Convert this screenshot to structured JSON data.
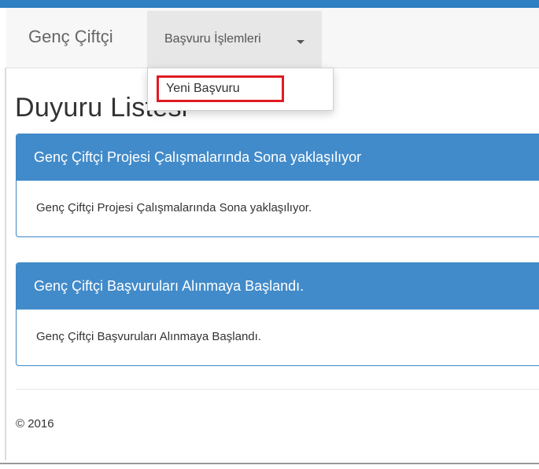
{
  "navbar": {
    "brand": "Genç Çiftçi",
    "menu_label": "Başvuru İşlemleri",
    "dropdown_items": [
      {
        "label": "Yeni Başvuru"
      }
    ]
  },
  "page": {
    "title": "Duyuru Listesi"
  },
  "announcements": [
    {
      "title": "Genç Çiftçi Projesi Çalışmalarında Sona yaklaşılıyor",
      "body": "Genç Çiftçi Projesi Çalışmalarında Sona yaklaşılıyor."
    },
    {
      "title": "Genç Çiftçi Başvuruları Alınmaya Başlandı.",
      "body": "Genç Çiftçi Başvuruları Alınmaya Başlandı."
    }
  ],
  "footer": {
    "copyright": "© 2016"
  },
  "colors": {
    "accent": "#428bca",
    "highlight": "#e01b24"
  }
}
